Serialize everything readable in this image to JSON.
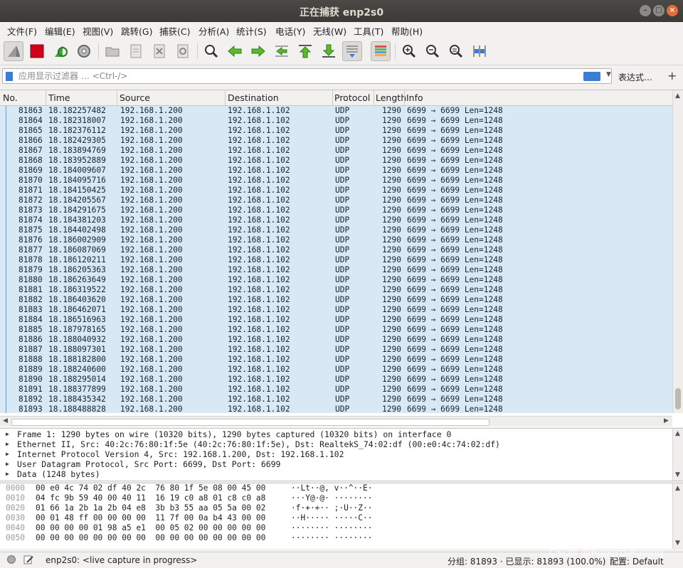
{
  "window": {
    "title": "正在捕获 enp2s0"
  },
  "menu": [
    "文件(F)",
    "编辑(E)",
    "视图(V)",
    "跳转(G)",
    "捕获(C)",
    "分析(A)",
    "统计(S)",
    "电话(Y)",
    "无线(W)",
    "工具(T)",
    "帮助(H)"
  ],
  "filter": {
    "placeholder": "应用显示过滤器 … <Ctrl-/>",
    "expression_label": "表达式…",
    "add_label": "+"
  },
  "columns": [
    "No.",
    "Time",
    "Source",
    "Destination",
    "Protocol",
    "Length",
    "Info"
  ],
  "packets": [
    {
      "no": "81863",
      "time": "18.182257482",
      "src": "192.168.1.200",
      "dst": "192.168.1.102",
      "proto": "UDP",
      "len": "1290",
      "info": "6699 → 6699 Len=1248"
    },
    {
      "no": "81864",
      "time": "18.182318007",
      "src": "192.168.1.200",
      "dst": "192.168.1.102",
      "proto": "UDP",
      "len": "1290",
      "info": "6699 → 6699 Len=1248"
    },
    {
      "no": "81865",
      "time": "18.182376112",
      "src": "192.168.1.200",
      "dst": "192.168.1.102",
      "proto": "UDP",
      "len": "1290",
      "info": "6699 → 6699 Len=1248"
    },
    {
      "no": "81866",
      "time": "18.182429305",
      "src": "192.168.1.200",
      "dst": "192.168.1.102",
      "proto": "UDP",
      "len": "1290",
      "info": "6699 → 6699 Len=1248"
    },
    {
      "no": "81867",
      "time": "18.183894769",
      "src": "192.168.1.200",
      "dst": "192.168.1.102",
      "proto": "UDP",
      "len": "1290",
      "info": "6699 → 6699 Len=1248"
    },
    {
      "no": "81868",
      "time": "18.183952889",
      "src": "192.168.1.200",
      "dst": "192.168.1.102",
      "proto": "UDP",
      "len": "1290",
      "info": "6699 → 6699 Len=1248"
    },
    {
      "no": "81869",
      "time": "18.184009607",
      "src": "192.168.1.200",
      "dst": "192.168.1.102",
      "proto": "UDP",
      "len": "1290",
      "info": "6699 → 6699 Len=1248"
    },
    {
      "no": "81870",
      "time": "18.184095716",
      "src": "192.168.1.200",
      "dst": "192.168.1.102",
      "proto": "UDP",
      "len": "1290",
      "info": "6699 → 6699 Len=1248"
    },
    {
      "no": "81871",
      "time": "18.184150425",
      "src": "192.168.1.200",
      "dst": "192.168.1.102",
      "proto": "UDP",
      "len": "1290",
      "info": "6699 → 6699 Len=1248"
    },
    {
      "no": "81872",
      "time": "18.184205567",
      "src": "192.168.1.200",
      "dst": "192.168.1.102",
      "proto": "UDP",
      "len": "1290",
      "info": "6699 → 6699 Len=1248"
    },
    {
      "no": "81873",
      "time": "18.184291675",
      "src": "192.168.1.200",
      "dst": "192.168.1.102",
      "proto": "UDP",
      "len": "1290",
      "info": "6699 → 6699 Len=1248"
    },
    {
      "no": "81874",
      "time": "18.184381203",
      "src": "192.168.1.200",
      "dst": "192.168.1.102",
      "proto": "UDP",
      "len": "1290",
      "info": "6699 → 6699 Len=1248"
    },
    {
      "no": "81875",
      "time": "18.184402498",
      "src": "192.168.1.200",
      "dst": "192.168.1.102",
      "proto": "UDP",
      "len": "1290",
      "info": "6699 → 6699 Len=1248"
    },
    {
      "no": "81876",
      "time": "18.186002909",
      "src": "192.168.1.200",
      "dst": "192.168.1.102",
      "proto": "UDP",
      "len": "1290",
      "info": "6699 → 6699 Len=1248"
    },
    {
      "no": "81877",
      "time": "18.186087069",
      "src": "192.168.1.200",
      "dst": "192.168.1.102",
      "proto": "UDP",
      "len": "1290",
      "info": "6699 → 6699 Len=1248"
    },
    {
      "no": "81878",
      "time": "18.186120211",
      "src": "192.168.1.200",
      "dst": "192.168.1.102",
      "proto": "UDP",
      "len": "1290",
      "info": "6699 → 6699 Len=1248"
    },
    {
      "no": "81879",
      "time": "18.186205363",
      "src": "192.168.1.200",
      "dst": "192.168.1.102",
      "proto": "UDP",
      "len": "1290",
      "info": "6699 → 6699 Len=1248"
    },
    {
      "no": "81880",
      "time": "18.186263649",
      "src": "192.168.1.200",
      "dst": "192.168.1.102",
      "proto": "UDP",
      "len": "1290",
      "info": "6699 → 6699 Len=1248"
    },
    {
      "no": "81881",
      "time": "18.186319522",
      "src": "192.168.1.200",
      "dst": "192.168.1.102",
      "proto": "UDP",
      "len": "1290",
      "info": "6699 → 6699 Len=1248"
    },
    {
      "no": "81882",
      "time": "18.186403620",
      "src": "192.168.1.200",
      "dst": "192.168.1.102",
      "proto": "UDP",
      "len": "1290",
      "info": "6699 → 6699 Len=1248"
    },
    {
      "no": "81883",
      "time": "18.186462071",
      "src": "192.168.1.200",
      "dst": "192.168.1.102",
      "proto": "UDP",
      "len": "1290",
      "info": "6699 → 6699 Len=1248"
    },
    {
      "no": "81884",
      "time": "18.186516963",
      "src": "192.168.1.200",
      "dst": "192.168.1.102",
      "proto": "UDP",
      "len": "1290",
      "info": "6699 → 6699 Len=1248"
    },
    {
      "no": "81885",
      "time": "18.187978165",
      "src": "192.168.1.200",
      "dst": "192.168.1.102",
      "proto": "UDP",
      "len": "1290",
      "info": "6699 → 6699 Len=1248"
    },
    {
      "no": "81886",
      "time": "18.188040932",
      "src": "192.168.1.200",
      "dst": "192.168.1.102",
      "proto": "UDP",
      "len": "1290",
      "info": "6699 → 6699 Len=1248"
    },
    {
      "no": "81887",
      "time": "18.188097301",
      "src": "192.168.1.200",
      "dst": "192.168.1.102",
      "proto": "UDP",
      "len": "1290",
      "info": "6699 → 6699 Len=1248"
    },
    {
      "no": "81888",
      "time": "18.188182800",
      "src": "192.168.1.200",
      "dst": "192.168.1.102",
      "proto": "UDP",
      "len": "1290",
      "info": "6699 → 6699 Len=1248"
    },
    {
      "no": "81889",
      "time": "18.188240600",
      "src": "192.168.1.200",
      "dst": "192.168.1.102",
      "proto": "UDP",
      "len": "1290",
      "info": "6699 → 6699 Len=1248"
    },
    {
      "no": "81890",
      "time": "18.188295014",
      "src": "192.168.1.200",
      "dst": "192.168.1.102",
      "proto": "UDP",
      "len": "1290",
      "info": "6699 → 6699 Len=1248"
    },
    {
      "no": "81891",
      "time": "18.188377899",
      "src": "192.168.1.200",
      "dst": "192.168.1.102",
      "proto": "UDP",
      "len": "1290",
      "info": "6699 → 6699 Len=1248"
    },
    {
      "no": "81892",
      "time": "18.188435342",
      "src": "192.168.1.200",
      "dst": "192.168.1.102",
      "proto": "UDP",
      "len": "1290",
      "info": "6699 → 6699 Len=1248"
    },
    {
      "no": "81893",
      "time": "18.188488828",
      "src": "192.168.1.200",
      "dst": "192.168.1.102",
      "proto": "UDP",
      "len": "1290",
      "info": "6699 → 6699 Len=1248"
    }
  ],
  "details": [
    "Frame 1: 1290 bytes on wire (10320 bits), 1290 bytes captured (10320 bits) on interface 0",
    "Ethernet II, Src: 40:2c:76:80:1f:5e (40:2c:76:80:1f:5e), Dst: RealtekS_74:02:df (00:e0:4c:74:02:df)",
    "Internet Protocol Version 4, Src: 192.168.1.200, Dst: 192.168.1.102",
    "User Datagram Protocol, Src Port: 6699, Dst Port: 6699",
    "Data (1248 bytes)"
  ],
  "hex": [
    {
      "offset": "0000",
      "bytes": "00 e0 4c 74 02 df 40 2c  76 80 1f 5e 08 00 45 00",
      "ascii": "··Lt··@, v··^··E·"
    },
    {
      "offset": "0010",
      "bytes": "04 fc 9b 59 40 00 40 11  16 19 c0 a8 01 c8 c0 a8",
      "ascii": "···Y@·@· ········"
    },
    {
      "offset": "0020",
      "bytes": "01 66 1a 2b 1a 2b 04 e8  3b b3 55 aa 05 5a 00 02",
      "ascii": "·f·+·+·· ;·U··Z··"
    },
    {
      "offset": "0030",
      "bytes": "00 01 48 ff 00 00 00 00  11 7f 00 0a b4 43 00 00",
      "ascii": "··H····· ·····C··"
    },
    {
      "offset": "0040",
      "bytes": "00 00 00 00 01 98 a5 e1  00 05 02 00 00 00 00 00",
      "ascii": "········ ········"
    },
    {
      "offset": "0050",
      "bytes": "00 00 00 00 00 00 00 00  00 00 00 00 00 00 00 00",
      "ascii": "········ ········"
    }
  ],
  "status": {
    "interface": "enp2s0: <live capture in progress>",
    "packets": "分组: 81893 · 已显示: 81893 (100.0%)",
    "profile": "配置: Default",
    "watermark": "CSDN @RobertsRuning"
  }
}
